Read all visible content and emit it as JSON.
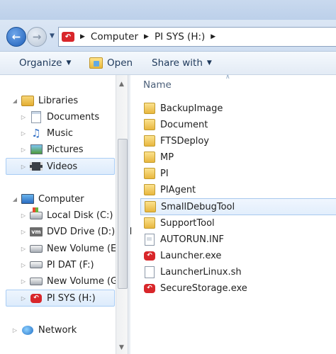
{
  "window": {
    "breadcrumbs": [
      "Computer",
      "PI SYS (H:)"
    ]
  },
  "toolbar": {
    "organize_label": "Organize",
    "open_label": "Open",
    "share_label": "Share with"
  },
  "nav": {
    "libraries": "Libraries",
    "library_items": [
      "Documents",
      "Music",
      "Pictures",
      "Videos"
    ],
    "computer": "Computer",
    "drives": [
      "Local Disk (C:)",
      "DVD Drive (D:) VM",
      "New Volume (E:)",
      "PI DAT (F:)",
      "New Volume (G:)",
      "PI SYS (H:)"
    ],
    "network": "Network",
    "vm_badge": "vm"
  },
  "content": {
    "column_name": "Name",
    "files": [
      {
        "name": "BackupImage",
        "icon": "folder-icon"
      },
      {
        "name": "Document",
        "icon": "folder-icon"
      },
      {
        "name": "FTSDeploy",
        "icon": "folder-icon"
      },
      {
        "name": "MP",
        "icon": "folder-icon"
      },
      {
        "name": "PI",
        "icon": "folder-icon"
      },
      {
        "name": "PIAgent",
        "icon": "folder-icon"
      },
      {
        "name": "SmallDebugTool",
        "icon": "folder-icon"
      },
      {
        "name": "SupportTool",
        "icon": "folder-icon"
      },
      {
        "name": "AUTORUN.INF",
        "icon": "inf-file-icon"
      },
      {
        "name": "Launcher.exe",
        "icon": "app-icon"
      },
      {
        "name": "LauncherLinux.sh",
        "icon": "script-file-icon"
      },
      {
        "name": "SecureStorage.exe",
        "icon": "app-icon"
      }
    ]
  },
  "colors": {
    "selection": "#dcebfc",
    "brand_red": "#d8262a"
  }
}
